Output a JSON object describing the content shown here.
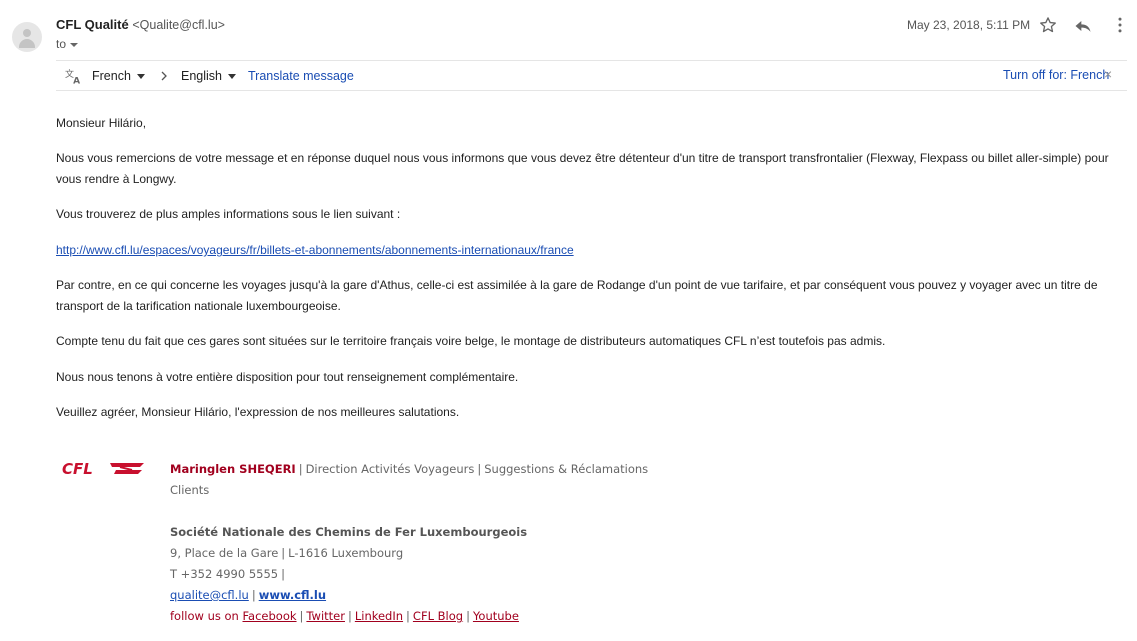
{
  "header": {
    "sender_name": "CFL Qualité",
    "sender_email": "<Qualite@cfl.lu>",
    "to_label": "to",
    "date": "May 23, 2018, 5:11 PM",
    "icons": [
      "avatar-icon",
      "star-icon",
      "reply-icon",
      "more-vert-icon"
    ]
  },
  "translate_bar": {
    "source_language": "French",
    "target_language": "English",
    "translate_link": "Translate message",
    "turn_off": "Turn off for: French",
    "close": "×"
  },
  "body": {
    "greeting": "Monsieur Hilário,",
    "p1": "Nous vous remercions de votre message et en réponse duquel nous vous informons que vous devez être détenteur d'un titre de transport transfrontalier (Flexway, Flexpass ou billet aller-simple) pour vous rendre à Longwy.",
    "p2": "Vous trouverez de plus amples informations sous le lien suivant :",
    "link": "http://www.cfl.lu/espaces/voyageurs/fr/billets-et-abonnements/abonnements-internationaux/france",
    "p3": "Par contre, en ce qui concerne les voyages jusqu'à la gare d'Athus, celle-ci est assimilée à la gare de Rodange d'un point de vue tarifaire, et par conséquent vous pouvez y voyager avec un titre de transport de la tarification nationale luxembourgeoise.",
    "p4": "Compte tenu du fait que ces gares sont situées sur le territoire français voire belge, le montage de distributeurs automatiques CFL n’est toutefois pas admis.",
    "p5": "Nous nous tenons à votre entière disposition pour tout renseignement complémentaire.",
    "p6": "Veuillez agréer, Monsieur Hilário, l'expression de nos meilleures salutations."
  },
  "signature": {
    "logo_text": "CFL",
    "name": "Maringlen SHEQERI",
    "department": "Direction Activités Voyageurs",
    "team": "Suggestions & Réclamations",
    "team_cont": "Clients",
    "company": "Société Nationale des Chemins de Fer Luxembourgeois",
    "address1": "9, Place de la Gare",
    "address2": "L-1616 Luxembourg",
    "phone": "T +352 4990 5555",
    "email": "qualite@cfl.lu",
    "website": "www.cfl.lu",
    "follow_label": "follow us on",
    "social": [
      "Facebook",
      "Twitter",
      "LinkedIn",
      "CFL Blog",
      "Youtube"
    ],
    "separator": "|"
  },
  "colors": {
    "link_blue": "#1a4db3",
    "brand_red": "#a1001e",
    "text": "#222222"
  }
}
